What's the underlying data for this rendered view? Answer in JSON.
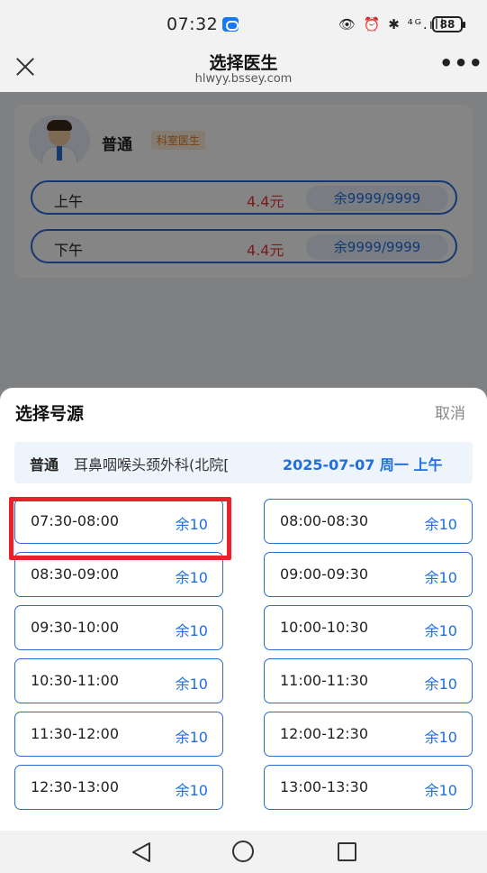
{
  "status_bar": {
    "time": "07:32",
    "icons": "👁 ⏰ ✱ ⁴ᴳ.ıll",
    "battery": "88"
  },
  "header": {
    "title": "选择医生",
    "subtitle": "hlwyy.bssey.com",
    "more": "•••"
  },
  "doctor": {
    "name": "普通",
    "tag": "科室医生",
    "sessions": [
      {
        "label": "上午",
        "price": "4.4元",
        "remaining": "余9999/9999"
      },
      {
        "label": "下午",
        "price": "4.4元",
        "remaining": "余9999/9999"
      }
    ]
  },
  "sheet": {
    "title": "选择号源",
    "cancel": "取消",
    "info": {
      "type": "普通",
      "department": "耳鼻咽喉头颈外科(北院[",
      "date": "2025-07-07 周一 上午"
    },
    "slots": [
      {
        "time": "07:30-08:00",
        "remaining": "余10",
        "selected": true
      },
      {
        "time": "08:00-08:30",
        "remaining": "余10"
      },
      {
        "time": "08:30-09:00",
        "remaining": "余10"
      },
      {
        "time": "09:00-09:30",
        "remaining": "余10"
      },
      {
        "time": "09:30-10:00",
        "remaining": "余10"
      },
      {
        "time": "10:00-10:30",
        "remaining": "余10"
      },
      {
        "time": "10:30-11:00",
        "remaining": "余10"
      },
      {
        "time": "11:00-11:30",
        "remaining": "余10"
      },
      {
        "time": "11:30-12:00",
        "remaining": "余10"
      },
      {
        "time": "12:00-12:30",
        "remaining": "余10"
      },
      {
        "time": "12:30-13:00",
        "remaining": "余10"
      },
      {
        "time": "13:00-13:30",
        "remaining": "余10"
      }
    ]
  },
  "colors": {
    "accent": "#2b6bd6",
    "price": "#e53935",
    "highlight": "#e8212a",
    "tag": "#e67a1f"
  }
}
